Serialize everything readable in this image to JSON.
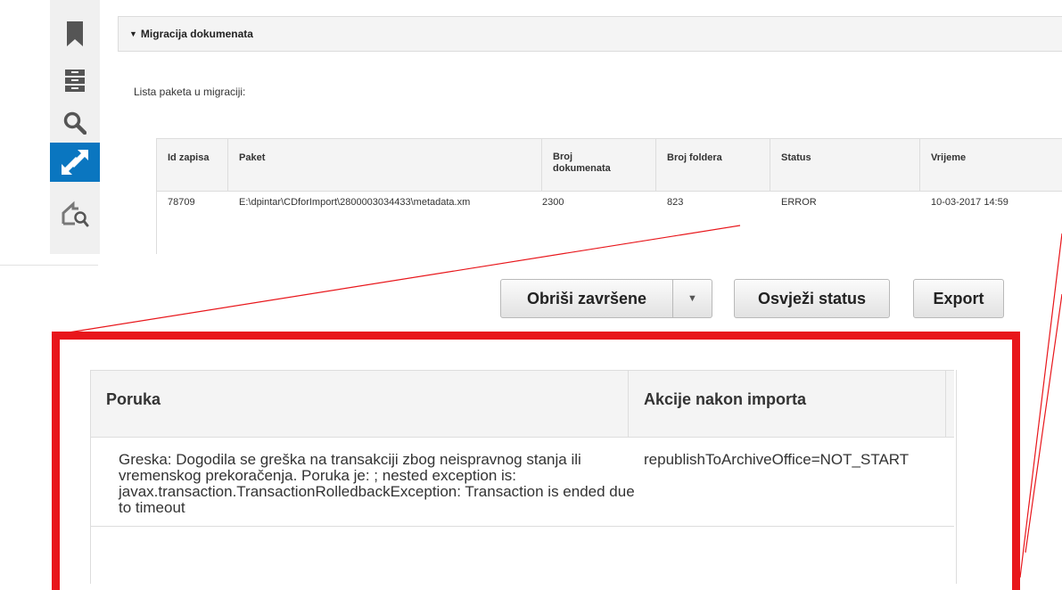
{
  "sidebar": {
    "items": [
      {
        "icon": "bookmark-icon",
        "active": false
      },
      {
        "icon": "archive-box-icon",
        "active": false
      },
      {
        "icon": "search-icon",
        "active": false
      },
      {
        "icon": "migration-arrows-icon",
        "active": true
      },
      {
        "icon": "folder-search-icon",
        "active": false
      }
    ]
  },
  "panel": {
    "title": "Migracija dokumenata",
    "list_label": "Lista paketa u migraciji:"
  },
  "table": {
    "columns": [
      "Id zapisa",
      "Paket",
      "Broj dokumenata",
      "Broj foldera",
      "Status",
      "Vrijeme"
    ],
    "rows": [
      {
        "id": "78709",
        "paket": "E:\\dpintar\\CDforImport\\2800003034433\\metadata.xm",
        "broj_dokumenata": "2300",
        "broj_foldera": "823",
        "status": "ERROR",
        "vrijeme": "10-03-2017 14:59"
      }
    ]
  },
  "buttons": {
    "delete_finished": "Obriši završene",
    "refresh_status": "Osvježi status",
    "export": "Export"
  },
  "zoom": {
    "columns": [
      "Poruka",
      "Akcije nakon importa"
    ],
    "message": "Greska: Dogodila se greška na transakciji zbog neispravnog stanja ili vremenskog prekoračenja. Poruka je: ; nested exception is: javax.transaction.TransactionRolledbackException: Transaction is ended due to timeout",
    "action": "republishToArchiveOffice=NOT_START"
  },
  "colors": {
    "accent": "#0a76c0",
    "highlight": "#e8161b"
  }
}
